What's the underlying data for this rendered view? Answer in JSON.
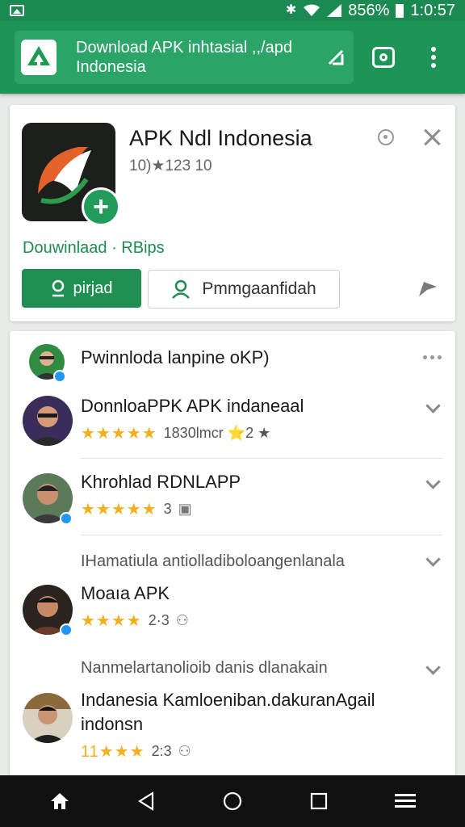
{
  "status_bar": {
    "battery_text": "856%",
    "time": "1:0:57"
  },
  "browser": {
    "url_line1": "Download APK inhtasial ,,/apd",
    "url_line2": "Indonesia"
  },
  "app_card": {
    "name": "APK Ndl Indonesia",
    "meta": "10)★123 10",
    "developer": "Douwinlaad · RBips",
    "primary_button": "pirjad",
    "secondary_button": "Pmmgaanfidah"
  },
  "list": {
    "header_text": "Pwinnloda lanpine oKP)",
    "items": [
      {
        "title": "DonnloaPPK APK indaneaal",
        "rating_text": "1830lmcr ⭐2 ★",
        "stars": "★★★★★"
      },
      {
        "title": "Khrohlad RDNLAPP",
        "rating_text": "3",
        "stars": "★★★★★"
      },
      {
        "caption": "IHamatiula antiolladiboloangenlanala",
        "title": "Moaıa APK",
        "rating_text": "2·3",
        "stars": "★★★★"
      },
      {
        "caption": "Nanmelartanolioib danis dlanakain",
        "title": "Indanesia Kamloeniban.dakuranAgail",
        "title_line2": "indonsn",
        "rating_text": "2:3",
        "stars": "11★★★"
      }
    ]
  },
  "colors": {
    "primary_green": "#1e9457",
    "status_green": "#1b8a52",
    "star_gold": "#f2b01e",
    "nav_bg": "#101010"
  },
  "icons": {
    "status": [
      "image-icon",
      "bluetooth-icon",
      "wifi-icon",
      "signal-icon",
      "battery-icon"
    ],
    "toolbar": [
      "site-logo-icon",
      "edit-url-icon",
      "camera-icon",
      "more-vert-icon"
    ],
    "nav": [
      "home-icon",
      "back-icon",
      "circle-home-icon",
      "recents-icon",
      "menu-icon"
    ]
  }
}
